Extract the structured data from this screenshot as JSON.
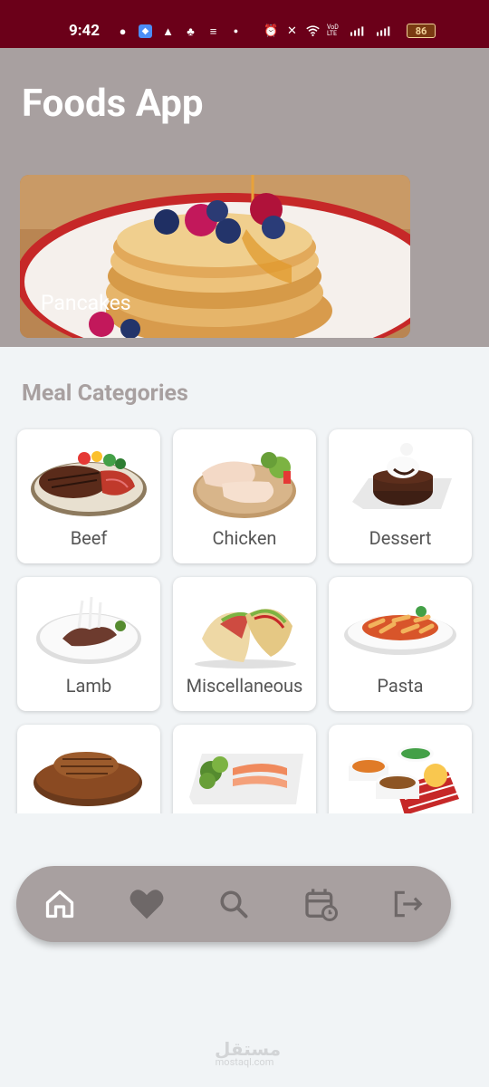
{
  "status_bar": {
    "time": "9:42",
    "battery": "86",
    "network_label": "VoD LTE"
  },
  "app": {
    "title": "Foods App"
  },
  "featured_meal": {
    "label": "Pancakes"
  },
  "categories_section": {
    "title": "Meal Categories",
    "items": [
      {
        "label": "Beef"
      },
      {
        "label": "Chicken"
      },
      {
        "label": "Dessert"
      },
      {
        "label": "Lamb"
      },
      {
        "label": "Miscellaneous"
      },
      {
        "label": "Pasta"
      },
      {
        "label": ""
      },
      {
        "label": ""
      },
      {
        "label": ""
      }
    ]
  },
  "bottom_nav": {
    "items": [
      {
        "icon": "home-icon",
        "active": true
      },
      {
        "icon": "heart-icon",
        "active": false
      },
      {
        "icon": "search-icon",
        "active": false
      },
      {
        "icon": "calendar-icon",
        "active": false
      },
      {
        "icon": "logout-icon",
        "active": false
      }
    ]
  },
  "watermark": {
    "arabic": "مستقل",
    "latin": "mostaql.com"
  },
  "colors": {
    "status_bar": "#6b0019",
    "header": "#a8a0a0",
    "background": "#f1f4f6",
    "nav_active_icon": "#ffffff",
    "nav_inactive_icon": "#6e6868"
  }
}
